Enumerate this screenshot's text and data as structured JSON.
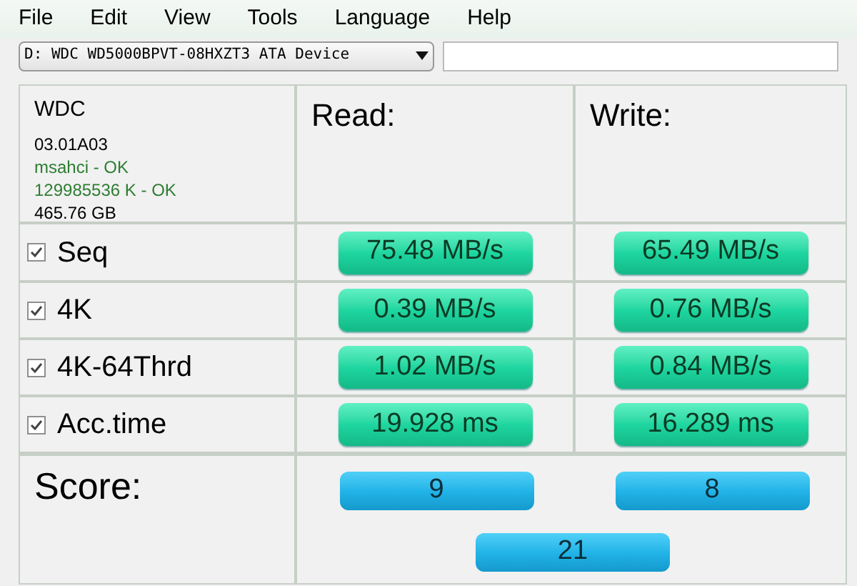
{
  "menu": [
    "File",
    "Edit",
    "View",
    "Tools",
    "Language",
    "Help"
  ],
  "drive_select": {
    "value": "D: WDC WD5000BPVT-08HXZT3 ATA Device"
  },
  "drive_info": [
    {
      "text": "WDC",
      "kind": "title"
    },
    {
      "text": "03.01A03",
      "kind": "plain"
    },
    {
      "text": "msahci - OK",
      "kind": "ok"
    },
    {
      "text": "129985536 K - OK",
      "kind": "ok"
    },
    {
      "text": "465.76 GB",
      "kind": "plain"
    }
  ],
  "headers": {
    "read": "Read:",
    "write": "Write:"
  },
  "tests": [
    {
      "name": "Seq",
      "checked": true,
      "read": "75.48 MB/s",
      "write": "65.49 MB/s"
    },
    {
      "name": "4K",
      "checked": true,
      "read": "0.39 MB/s",
      "write": "0.76 MB/s"
    },
    {
      "name": "4K-64Thrd",
      "checked": true,
      "read": "1.02 MB/s",
      "write": "0.84 MB/s"
    },
    {
      "name": "Acc.time",
      "checked": true,
      "read": "19.928 ms",
      "write": "16.289 ms"
    }
  ],
  "score": {
    "label": "Score:",
    "read": "9",
    "write": "8",
    "total": "21"
  }
}
